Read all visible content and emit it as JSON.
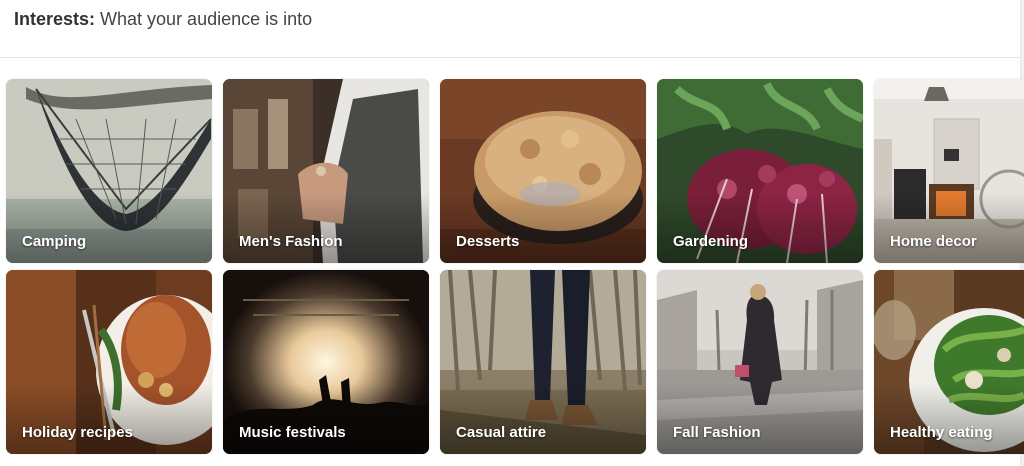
{
  "header": {
    "title_bold": "Interests:",
    "title_rest": " What your audience is into"
  },
  "interests": [
    {
      "label": "Camping"
    },
    {
      "label": "Men's Fashion"
    },
    {
      "label": "Desserts"
    },
    {
      "label": "Gardening"
    },
    {
      "label": "Home decor"
    },
    {
      "label": "Holiday recipes"
    },
    {
      "label": "Music festivals"
    },
    {
      "label": "Casual attire"
    },
    {
      "label": "Fall Fashion"
    },
    {
      "label": "Healthy eating"
    }
  ],
  "colors": {
    "header_text": "#333333",
    "divider": "#e6e6e6",
    "label_text": "#ffffff"
  }
}
